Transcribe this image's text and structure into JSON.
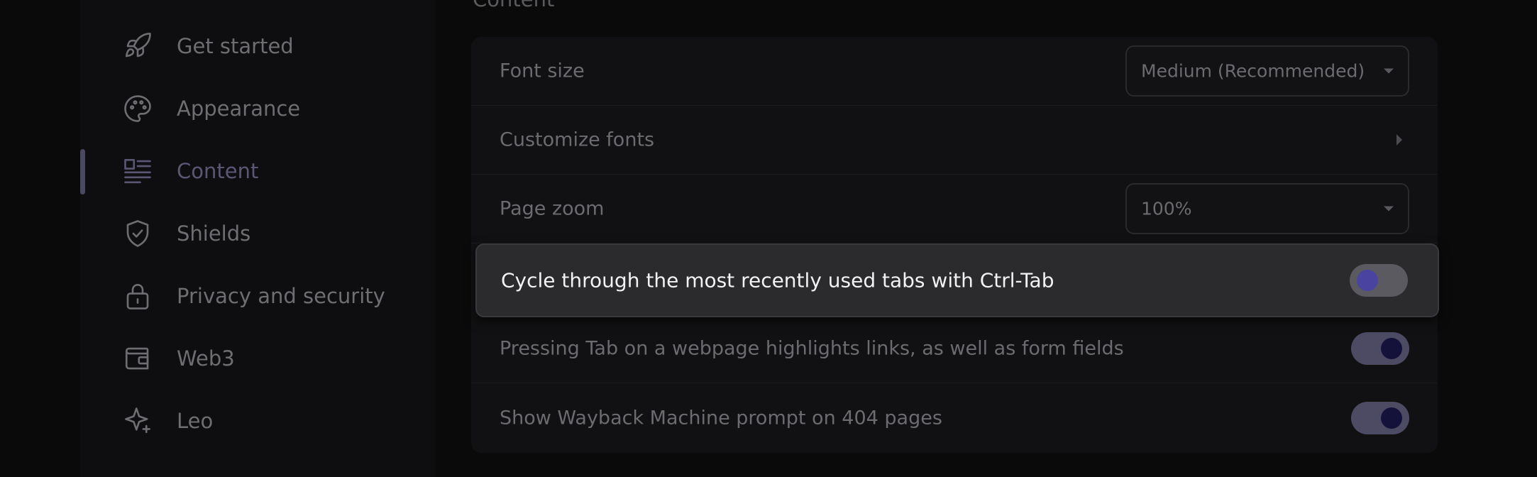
{
  "sidebar": {
    "items": [
      {
        "label": "Get started",
        "icon": "rocket-icon"
      },
      {
        "label": "Appearance",
        "icon": "palette-icon"
      },
      {
        "label": "Content",
        "icon": "content-layout-icon",
        "active": true
      },
      {
        "label": "Shields",
        "icon": "shield-check-icon"
      },
      {
        "label": "Privacy and security",
        "icon": "lock-icon"
      },
      {
        "label": "Web3",
        "icon": "wallet-icon"
      },
      {
        "label": "Leo",
        "icon": "sparkle-icon"
      }
    ]
  },
  "main": {
    "section_title": "Content",
    "rows": {
      "font_size": {
        "label": "Font size",
        "value": "Medium (Recommended)"
      },
      "customize_fonts": {
        "label": "Customize fonts"
      },
      "page_zoom": {
        "label": "Page zoom",
        "value": "100%"
      },
      "cycle_tabs": {
        "label": "Cycle through the most recently used tabs with Ctrl-Tab",
        "enabled": false
      },
      "tab_highlight": {
        "label": "Pressing Tab on a webpage highlights links, as well as form fields",
        "enabled": true
      },
      "wayback": {
        "label": "Show Wayback Machine prompt on 404 pages",
        "enabled": true
      }
    }
  },
  "colors": {
    "accent": "#4a44a0",
    "toggle_on_track": "#4d4b63",
    "toggle_on_knob": "#14123a",
    "highlight_bg": "#2b2b2e"
  }
}
